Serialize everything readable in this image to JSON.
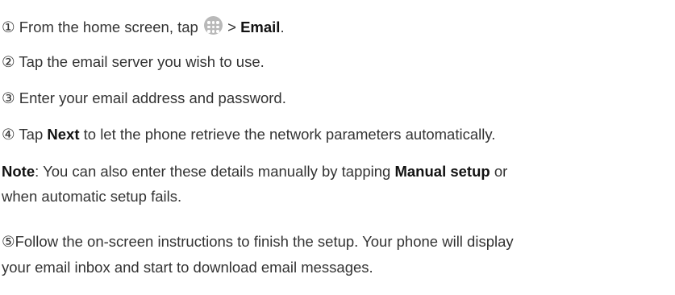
{
  "steps": [
    {
      "marker": "①",
      "pre": " From the home screen, tap ",
      "icon": "apps-icon",
      "mid": " > ",
      "bold": "Email",
      "post": "."
    },
    {
      "marker": "②",
      "text": " Tap the email server you wish to use."
    },
    {
      "marker": "③",
      "text": " Enter your email address and password."
    },
    {
      "marker": "④",
      "pre": " Tap ",
      "bold": "Next",
      "post": " to let the phone retrieve the network parameters automatically."
    }
  ],
  "note": {
    "label": "Note",
    "pre": ": You can also enter these details manually by tapping ",
    "bold": "Manual setup",
    "post_line1": " or",
    "line2": "when automatic setup fails."
  },
  "step5": {
    "marker": "⑤",
    "line1": "Follow the on-screen instructions to finish the setup. Your phone will display",
    "line2": "your email inbox and start to download email messages."
  }
}
